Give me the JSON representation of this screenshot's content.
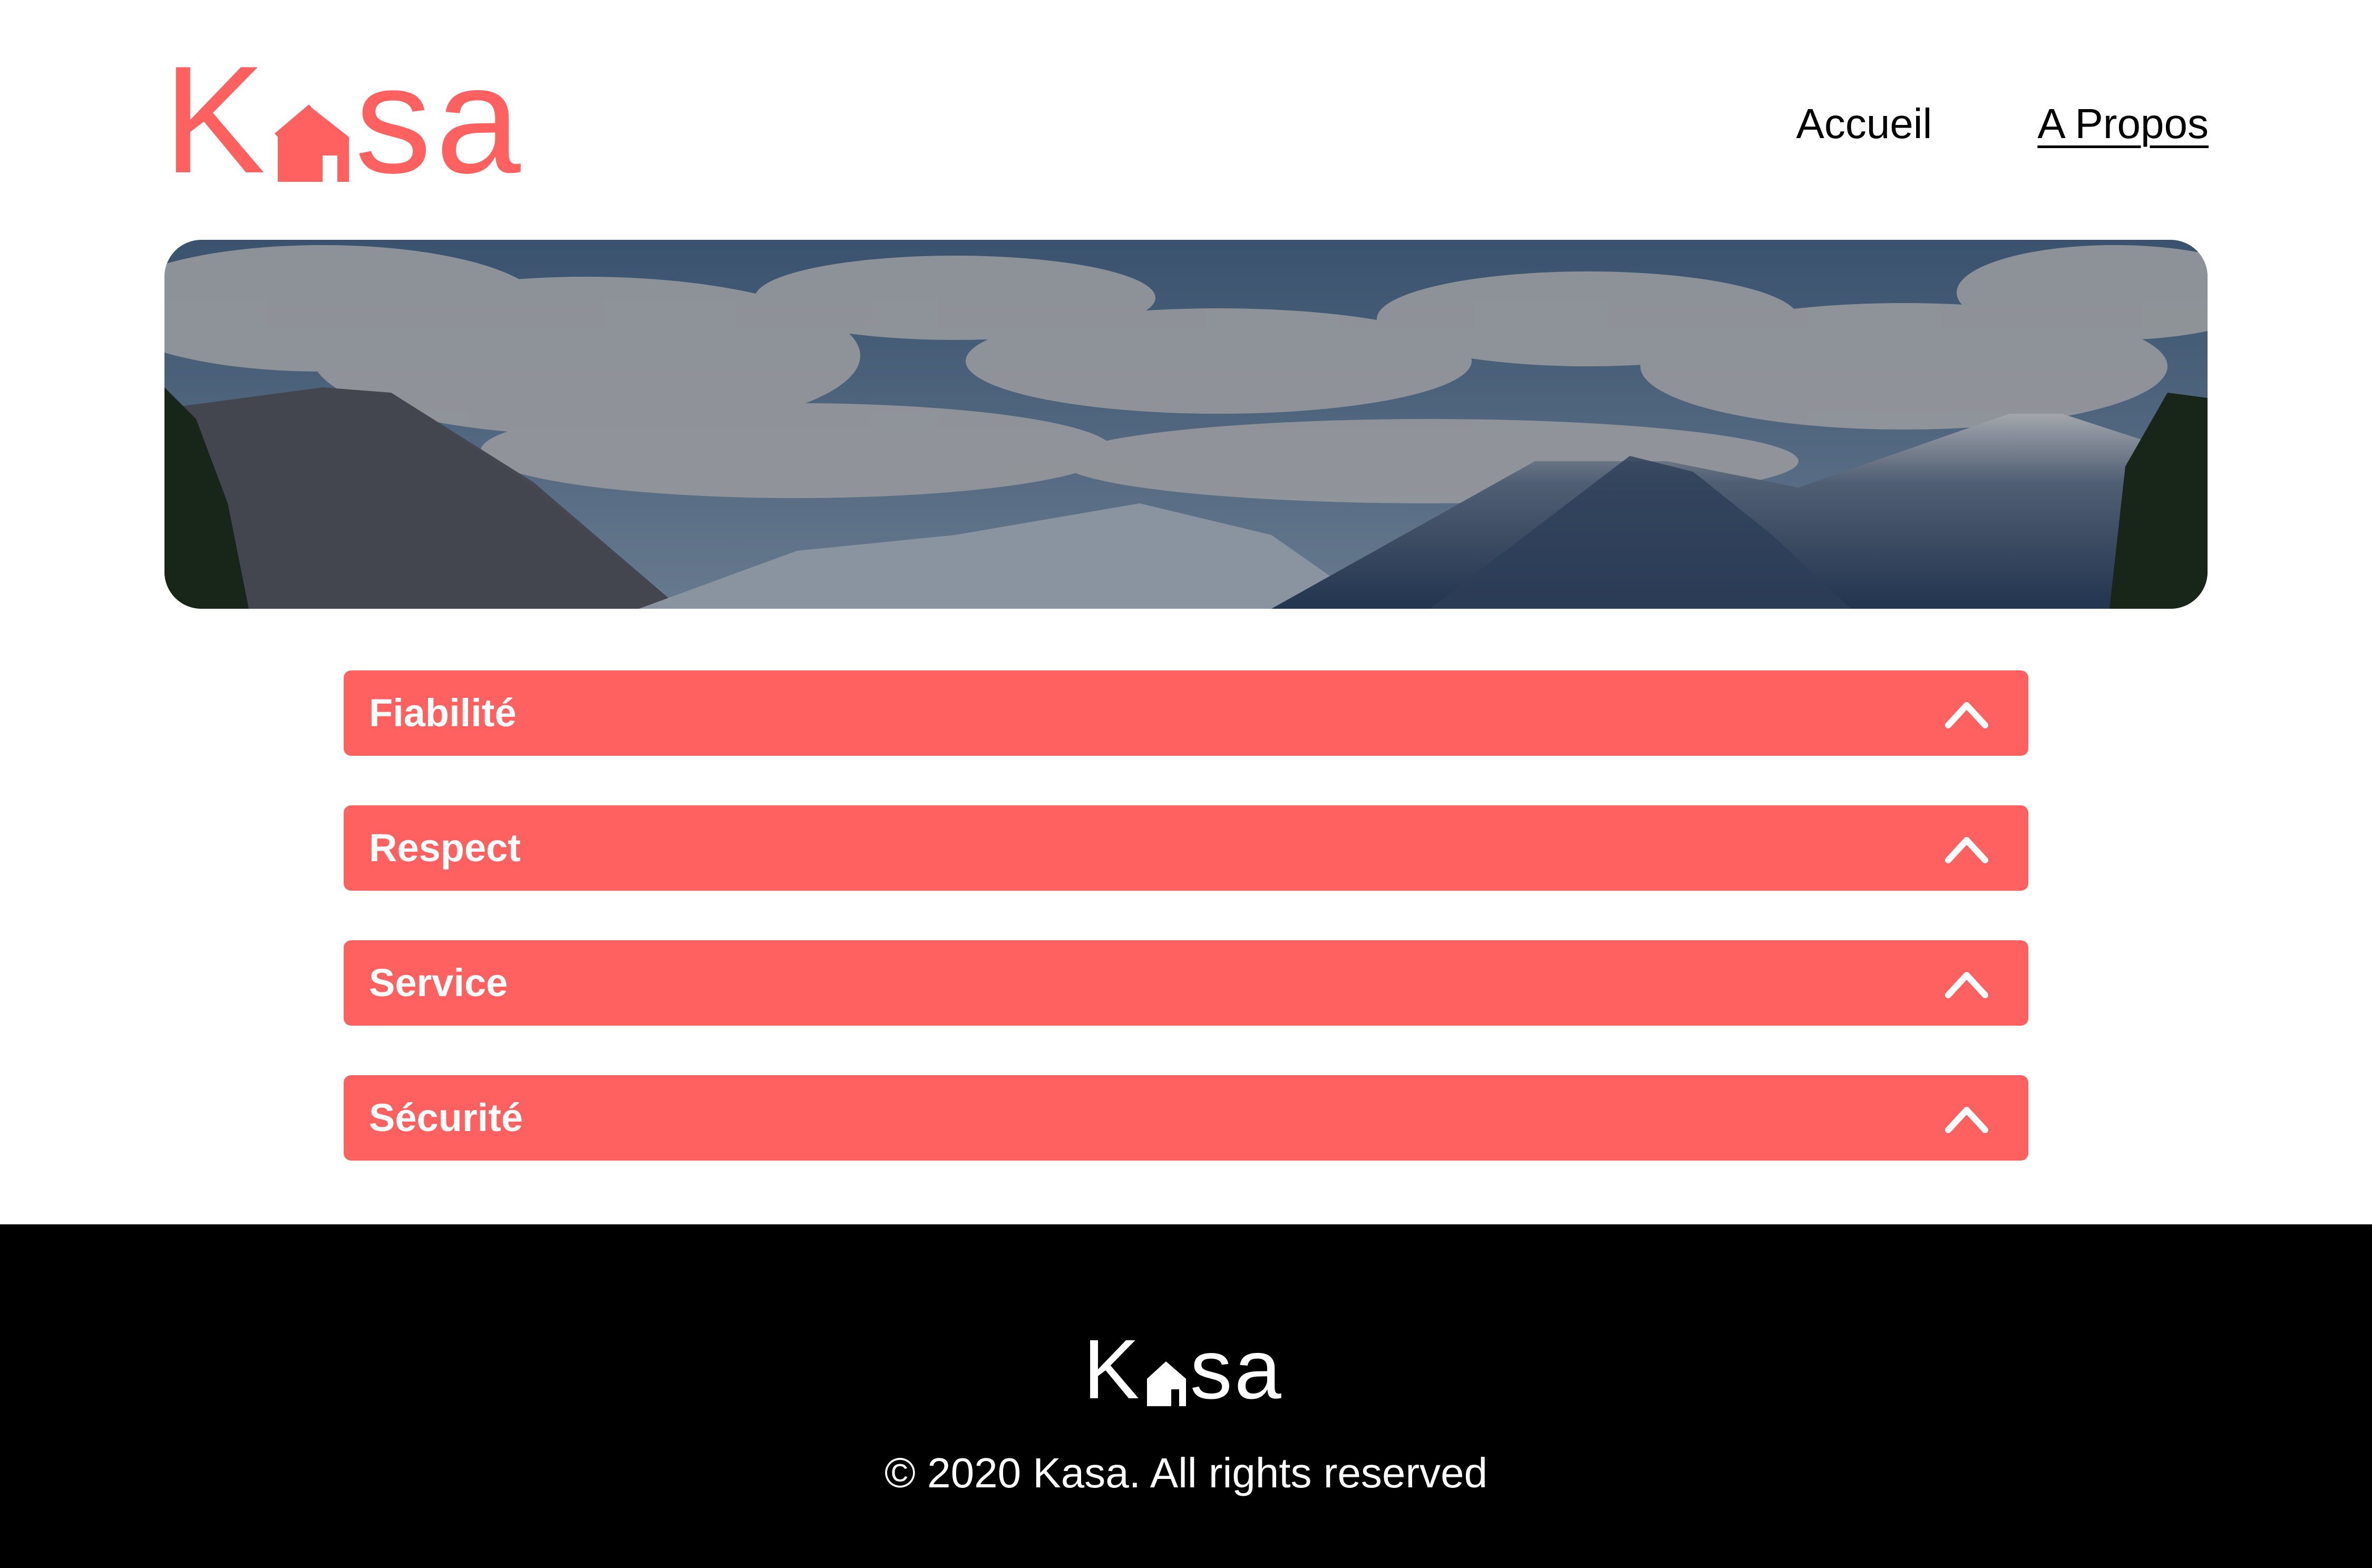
{
  "brand": {
    "logo_text_start": "K",
    "logo_text_end": "sa",
    "primary_color": "#ff6060",
    "footer_bg": "#000000"
  },
  "nav": {
    "items": [
      {
        "label": "Accueil",
        "active": false
      },
      {
        "label": "A Propos",
        "active": true
      }
    ]
  },
  "banner": {
    "image": "mountain-landscape"
  },
  "accordion": {
    "items": [
      {
        "title": "Fiabilité",
        "icon": "chevron-up-icon"
      },
      {
        "title": "Respect",
        "icon": "chevron-up-icon"
      },
      {
        "title": "Service",
        "icon": "chevron-up-icon"
      },
      {
        "title": "Sécurité",
        "icon": "chevron-up-icon"
      }
    ]
  },
  "footer": {
    "copyright": "© 2020 Kasa. All rights reserved"
  }
}
